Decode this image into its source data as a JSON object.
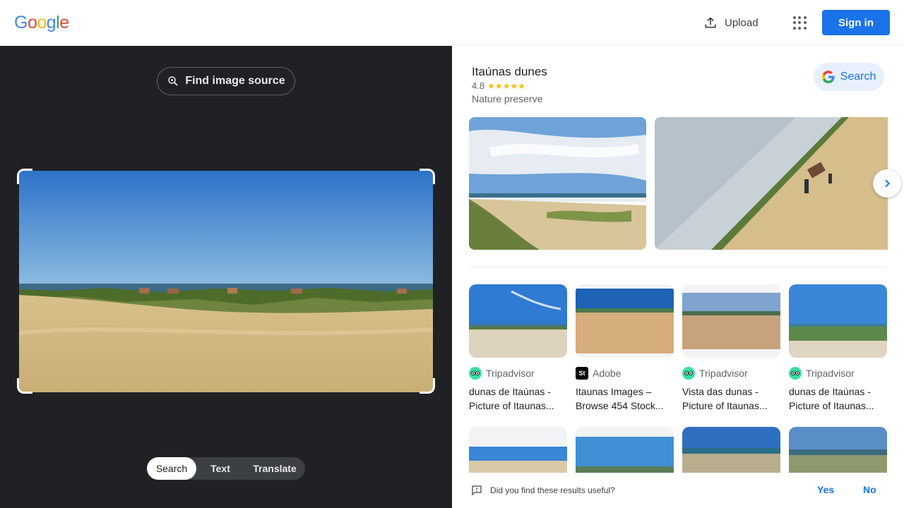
{
  "header": {
    "logo": [
      "G",
      "o",
      "o",
      "g",
      "l",
      "e"
    ],
    "logo_colors": [
      "#4285f4",
      "#ea4335",
      "#fbbc05",
      "#4285f4",
      "#34a853",
      "#ea4335"
    ],
    "upload_label": "Upload",
    "apps_icon": "apps-grid-icon",
    "signin_label": "Sign in"
  },
  "left": {
    "find_source_label": "Find image source",
    "modes": [
      {
        "label": "Search",
        "active": true
      },
      {
        "label": "Text",
        "active": false
      },
      {
        "label": "Translate",
        "active": false
      }
    ]
  },
  "knowledge_panel": {
    "title": "Itaúnas dunes",
    "rating": "4.8",
    "stars": "★★★★★",
    "type": "Nature preserve",
    "search_label": "Search"
  },
  "results": [
    {
      "source": "Tripadvisor",
      "title": "dunas de Itaúnas - Picture of Itaunas..."
    },
    {
      "source": "Adobe",
      "title": "Itaunas Images – Browse 454 Stock..."
    },
    {
      "source": "Tripadvisor",
      "title": "Vista das dunas - Picture of Itaunas..."
    },
    {
      "source": "Tripadvisor",
      "title": "dunas de Itaúnas - Picture of Itaunas..."
    }
  ],
  "feedback": {
    "question": "Did you find these results useful?",
    "yes": "Yes",
    "no": "No"
  },
  "colors": {
    "accent": "#1a73e8",
    "dark_pane": "#202124",
    "tripadvisor": "#34e0a1",
    "star": "#fbbc04"
  }
}
